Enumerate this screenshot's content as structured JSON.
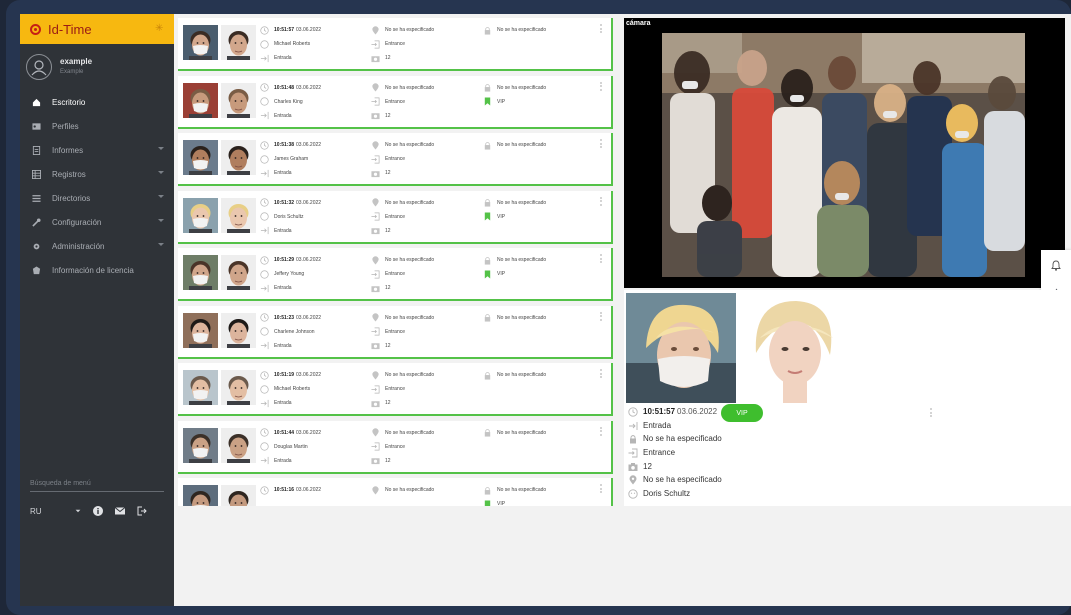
{
  "app": {
    "title": "Id-Time"
  },
  "user": {
    "name": "example",
    "role": "Example"
  },
  "menu": [
    {
      "label": "Escritorio",
      "icon": "home-icon",
      "caret": false,
      "active": true
    },
    {
      "label": "Perfiles",
      "icon": "id-card-icon",
      "caret": false,
      "active": false
    },
    {
      "label": "Informes",
      "icon": "report-icon",
      "caret": true,
      "active": false
    },
    {
      "label": "Registros",
      "icon": "table-icon",
      "caret": true,
      "active": false
    },
    {
      "label": "Directorios",
      "icon": "list-icon",
      "caret": true,
      "active": false
    },
    {
      "label": "Configuración",
      "icon": "wrench-icon",
      "caret": true,
      "active": false
    },
    {
      "label": "Administración",
      "icon": "gear-icon",
      "caret": true,
      "active": false
    },
    {
      "label": "Información de licencia",
      "icon": "license-icon",
      "caret": false,
      "active": false
    }
  ],
  "search": {
    "placeholder": "Búsqueda de menú"
  },
  "footer": {
    "language": "RU"
  },
  "events": [
    {
      "time": "10:51:57",
      "date": "03.06.2022",
      "name": "Michael Roberts",
      "direction": "Entrada",
      "location": "No se ha especificado",
      "gate": "Entrance",
      "camera": "12",
      "access": "No se ha especificado",
      "tag": ""
    },
    {
      "time": "10:51:48",
      "date": "03.06.2022",
      "name": "Charles King",
      "direction": "Entrada",
      "location": "No se ha especificado",
      "gate": "Entrance",
      "camera": "12",
      "access": "No se ha especificado",
      "tag": "VIP"
    },
    {
      "time": "10:51:38",
      "date": "03.06.2022",
      "name": "James Graham",
      "direction": "Entrada",
      "location": "No se ha especificado",
      "gate": "Entrance",
      "camera": "12",
      "access": "No se ha especificado",
      "tag": ""
    },
    {
      "time": "10:51:32",
      "date": "03.06.2022",
      "name": "Doris Schultz",
      "direction": "Entrada",
      "location": "No se ha especificado",
      "gate": "Entrance",
      "camera": "12",
      "access": "No se ha especificado",
      "tag": "VIP"
    },
    {
      "time": "10:51:29",
      "date": "03.06.2022",
      "name": "Jeffery Young",
      "direction": "Entrada",
      "location": "No se ha especificado",
      "gate": "Entrance",
      "camera": "12",
      "access": "No se ha especificado",
      "tag": "VIP"
    },
    {
      "time": "10:51:23",
      "date": "03.06.2022",
      "name": "Charlene Johnson",
      "direction": "Entrada",
      "location": "No se ha especificado",
      "gate": "Entrance",
      "camera": "12",
      "access": "No se ha especificado",
      "tag": ""
    },
    {
      "time": "10:51:19",
      "date": "03.06.2022",
      "name": "Michael Roberts",
      "direction": "Entrada",
      "location": "No se ha especificado",
      "gate": "Entrance",
      "camera": "12",
      "access": "No se ha especificado",
      "tag": ""
    },
    {
      "time": "10:51:44",
      "date": "03.06.2022",
      "name": "Douglas Martin",
      "direction": "Entrada",
      "location": "No se ha especificado",
      "gate": "Entrance",
      "camera": "12",
      "access": "No se ha especificado",
      "tag": ""
    },
    {
      "time": "10:51:16",
      "date": "03.06.2022",
      "name": "",
      "direction": "",
      "location": "No se ha especificado",
      "gate": "",
      "camera": "",
      "access": "No se ha especificado",
      "tag": "VIP"
    }
  ],
  "camera": {
    "label": "cámara"
  },
  "detail": {
    "time": "10:51:57",
    "date": "03.06.2022",
    "tag": "VIP",
    "direction": "Entrada",
    "access": "No se ha especificado",
    "gate": "Entrance",
    "camera": "12",
    "location": "No se ha especificado",
    "name": "Doris Schultz"
  },
  "colors": {
    "accent": "#f7b810",
    "sidebar": "#2f3338",
    "success": "#54c248"
  }
}
